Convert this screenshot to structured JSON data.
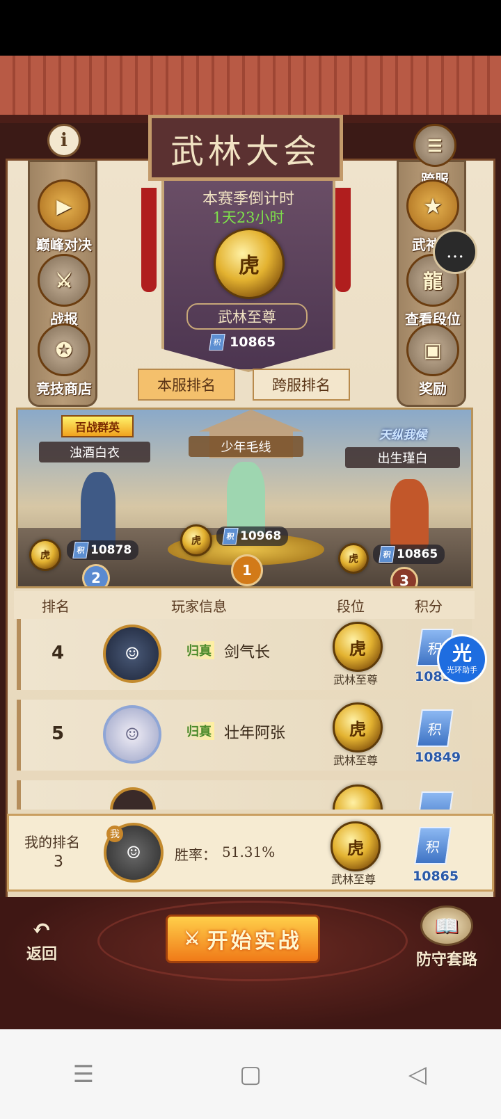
{
  "header": {
    "title": "武林大会",
    "info_icon": "info-icon",
    "crossserver_label": "跨服"
  },
  "left_menu": [
    {
      "label": "巅峰对决",
      "icon": "play-icon"
    },
    {
      "label": "战报",
      "icon": "crossed-swords-icon"
    },
    {
      "label": "竞技商店",
      "icon": "shop-icon"
    }
  ],
  "right_menu": [
    {
      "label": "武神殿",
      "icon": "shrine-icon"
    },
    {
      "label": "查看段位",
      "icon": "dragon-icon"
    },
    {
      "label": "奖励",
      "icon": "chest-icon"
    }
  ],
  "season": {
    "countdown_label": "本赛季倒计时",
    "countdown_value": "1天23小时",
    "tier": "武林至尊",
    "score_icon_text": "积",
    "score": "10865"
  },
  "tabs": {
    "local": "本服排名",
    "cross": "跨服排名"
  },
  "podium": [
    {
      "rank": "2",
      "name": "浊酒白衣",
      "title_badge": "百战群英",
      "score": "10878"
    },
    {
      "rank": "1",
      "name": "少年毛线",
      "score": "10968"
    },
    {
      "rank": "3",
      "name": "出生瑾白",
      "title_badge": "天纵我候",
      "score": "10865"
    }
  ],
  "table": {
    "headers": [
      "排名",
      "玩家信息",
      "段位",
      "积分"
    ],
    "rows": [
      {
        "rank": "4",
        "level": "归真",
        "name": "剑气长",
        "tier": "武林至尊",
        "score": "1085"
      },
      {
        "rank": "5",
        "level": "归真",
        "name": "壮年阿张",
        "tier": "武林至尊",
        "score": "10849"
      }
    ]
  },
  "my_rank": {
    "label": "我的排名",
    "rank": "3",
    "me_tag": "我",
    "winrate_label": "胜率：",
    "winrate": "51.31%",
    "tier": "武林至尊",
    "score": "10865"
  },
  "floating": {
    "helper_glyph": "光",
    "helper_label": "光环助手"
  },
  "bottom": {
    "back_label": "返回",
    "fight_label": "开始实战",
    "defense_label": "防守套路"
  },
  "colors": {
    "roof": "#b85a45",
    "banner": "#5b3a5a",
    "gold": "#e3b230",
    "score_blue": "#2b5aa8",
    "active_tab": "#f4c06c"
  }
}
